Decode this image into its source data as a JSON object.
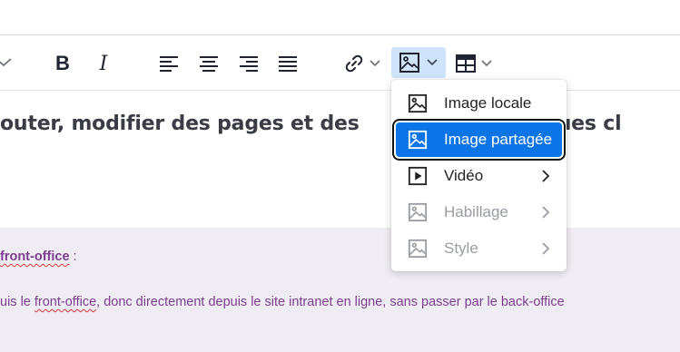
{
  "toolbar": {
    "tools": [
      {
        "name": "bold",
        "label": "B"
      },
      {
        "name": "italic",
        "label": "I"
      },
      {
        "name": "align-left"
      },
      {
        "name": "align-center"
      },
      {
        "name": "align-right"
      },
      {
        "name": "align-justify"
      },
      {
        "name": "link",
        "has_dropdown": true
      },
      {
        "name": "image",
        "has_dropdown": true,
        "active": true
      },
      {
        "name": "table",
        "has_dropdown": true
      }
    ]
  },
  "content": {
    "heading": "outer, modifier des pages et des",
    "heading_tail": "uelques cl",
    "line1_link": "front-office",
    "line1_suffix": " :",
    "line2_prefix": "uis le ",
    "line2_link": "front-office",
    "line2_suffix": ", donc directement depuis le site intranet en ligne, sans passer par le back-office"
  },
  "image_menu": {
    "items": [
      {
        "label": "Image locale",
        "icon": "image-icon",
        "disabled": false,
        "submenu": false,
        "selected": false
      },
      {
        "label": "Image partagée",
        "icon": "image-icon",
        "disabled": false,
        "submenu": false,
        "selected": true
      },
      {
        "label": "Vidéo",
        "icon": "video-play-icon",
        "disabled": false,
        "submenu": true,
        "selected": false
      },
      {
        "label": "Habillage",
        "icon": "image-icon",
        "disabled": true,
        "submenu": true,
        "selected": false
      },
      {
        "label": "Style",
        "icon": "image-icon",
        "disabled": true,
        "submenu": true,
        "selected": false
      }
    ]
  },
  "colors": {
    "accent": "#0b74e6",
    "active_button_bg": "#cfe4fa",
    "band_bg": "#f0ecf3",
    "link_text": "#7b3d8f",
    "disabled_text": "#9a9ca3"
  }
}
